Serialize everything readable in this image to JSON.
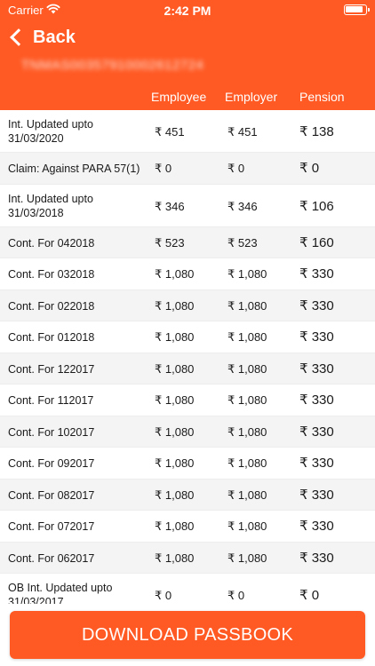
{
  "status_bar": {
    "carrier": "Carrier",
    "time": "2:42 PM"
  },
  "nav": {
    "back_label": "Back",
    "account_number": "TNMAS00357910002612724"
  },
  "columns": {
    "employee": "Employee",
    "employer": "Employer",
    "pension": "Pension"
  },
  "rows": [
    {
      "desc": "Int. Updated upto 31/03/2020",
      "employee": "₹ 451",
      "employer": "₹ 451",
      "pension": "₹ 138"
    },
    {
      "desc": "Claim: Against PARA 57(1)",
      "employee": "₹ 0",
      "employer": "₹ 0",
      "pension": "₹ 0"
    },
    {
      "desc": "Int. Updated upto 31/03/2018",
      "employee": "₹ 346",
      "employer": "₹ 346",
      "pension": "₹ 106"
    },
    {
      "desc": "Cont. For 042018",
      "employee": "₹ 523",
      "employer": "₹ 523",
      "pension": "₹ 160"
    },
    {
      "desc": "Cont. For 032018",
      "employee": "₹ 1,080",
      "employer": "₹ 1,080",
      "pension": "₹ 330"
    },
    {
      "desc": "Cont. For 022018",
      "employee": "₹ 1,080",
      "employer": "₹ 1,080",
      "pension": "₹ 330"
    },
    {
      "desc": "Cont. For 012018",
      "employee": "₹ 1,080",
      "employer": "₹ 1,080",
      "pension": "₹ 330"
    },
    {
      "desc": "Cont. For 122017",
      "employee": "₹ 1,080",
      "employer": "₹ 1,080",
      "pension": "₹ 330"
    },
    {
      "desc": "Cont. For 112017",
      "employee": "₹ 1,080",
      "employer": "₹ 1,080",
      "pension": "₹ 330"
    },
    {
      "desc": "Cont. For 102017",
      "employee": "₹ 1,080",
      "employer": "₹ 1,080",
      "pension": "₹ 330"
    },
    {
      "desc": "Cont. For 092017",
      "employee": "₹ 1,080",
      "employer": "₹ 1,080",
      "pension": "₹ 330"
    },
    {
      "desc": "Cont. For 082017",
      "employee": "₹ 1,080",
      "employer": "₹ 1,080",
      "pension": "₹ 330"
    },
    {
      "desc": "Cont. For 072017",
      "employee": "₹ 1,080",
      "employer": "₹ 1,080",
      "pension": "₹ 330"
    },
    {
      "desc": "Cont. For 062017",
      "employee": "₹ 1,080",
      "employer": "₹ 1,080",
      "pension": "₹ 330"
    },
    {
      "desc": "OB Int. Updated upto 31/03/2017",
      "employee": "₹ 0",
      "employer": "₹ 0",
      "pension": "₹ 0"
    }
  ],
  "download": {
    "label": "DOWNLOAD PASSBOOK"
  },
  "colors": {
    "accent": "#ff5a24",
    "row_alt": "#f4f4f4"
  },
  "icons": {
    "wifi": "wifi-icon",
    "battery": "battery-icon",
    "back": "chevron-left-icon"
  }
}
